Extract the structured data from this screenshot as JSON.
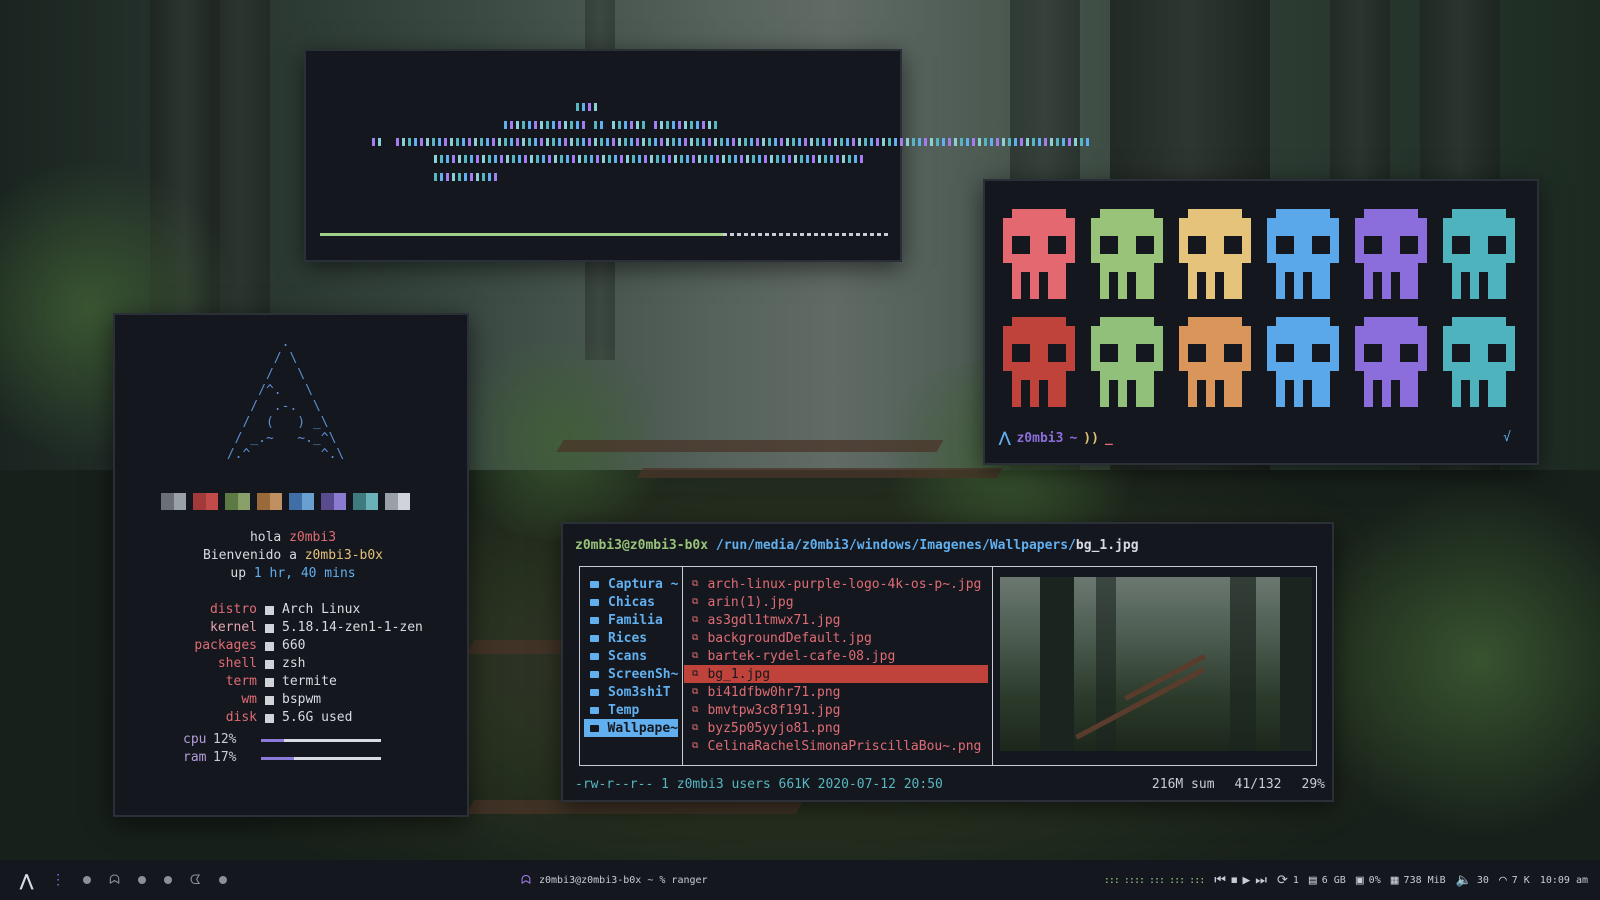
{
  "colors": {
    "bg_window": "#14171d",
    "red": "#e06c75",
    "green": "#98c379",
    "yellow": "#e5c07b",
    "blue": "#61afef",
    "purple": "#a37ef0",
    "cyan": "#56b6c2"
  },
  "visualizer": {
    "progress": 0.71
  },
  "skulls": {
    "row1": [
      "#e3686f",
      "#98c379",
      "#e6c37b",
      "#5aa8ea",
      "#8b6ddc",
      "#4eb3bd"
    ],
    "row2": [
      "#c0433b",
      "#90c079",
      "#d9955a",
      "#5aa8ea",
      "#8b6ddc",
      "#4eb3bd"
    ],
    "prompt": {
      "icon": "arch-icon",
      "user": "z0mbi3",
      "tilde": "~",
      "arrows": "))",
      "cursor": "_",
      "check": "√"
    }
  },
  "neofetch": {
    "ascii": "        .\n       / \\\n      /   \\\n     /^.   \\\n    /  .-.  \\\n   /  (   ) _\\\n  / _.~   ~._^\\\n /.^         ^.\\",
    "palette": [
      [
        "#6b6f76",
        "#9aa0a8"
      ],
      [
        "#a23a3a",
        "#c24a48"
      ],
      [
        "#5d7a44",
        "#8aa06a"
      ],
      [
        "#9a6a3a",
        "#c09060"
      ],
      [
        "#3f6fa6",
        "#6aa0d0"
      ],
      [
        "#5a4a8e",
        "#8a7ad0"
      ],
      [
        "#3e7a80",
        "#6ab2b8"
      ],
      [
        "#9aa0a8",
        "#d0d4da"
      ]
    ],
    "greeting": {
      "hola": "hola",
      "user": "z0mbi3",
      "welcome": "Bienvenido a",
      "host": "z0mbi3-b0x",
      "up_label": "up",
      "uptime": "1 hr, 40 mins"
    },
    "info": [
      {
        "key": "distro",
        "value": "Arch Linux"
      },
      {
        "key": "kernel",
        "value": "5.18.14-zen1-1-zen"
      },
      {
        "key": "packages",
        "value": "660"
      },
      {
        "key": "shell",
        "value": "zsh"
      },
      {
        "key": "term",
        "value": "termite"
      },
      {
        "key": "wm",
        "value": "bspwm"
      },
      {
        "key": "disk",
        "value": "5.6G used"
      }
    ],
    "meters": [
      {
        "key": "cpu",
        "value": "12%",
        "fraction": 0.12
      },
      {
        "key": "ram",
        "value": "17%",
        "fraction": 0.17
      }
    ]
  },
  "ranger": {
    "userhost": "z0mbi3@z0mbi3-b0x",
    "path": "/run/media/z0mbi3/windows/Imagenes/Wallpapers/",
    "file": "bg_1.jpg",
    "dirs": [
      {
        "name": "Captura ~",
        "selected": false
      },
      {
        "name": "Chicas",
        "selected": false
      },
      {
        "name": "Familia",
        "selected": false
      },
      {
        "name": "Rices",
        "selected": false
      },
      {
        "name": "Scans",
        "selected": false
      },
      {
        "name": "ScreenSh~",
        "selected": false
      },
      {
        "name": "Som3shiT",
        "selected": false
      },
      {
        "name": "Temp",
        "selected": false
      },
      {
        "name": "Wallpape~",
        "selected": true
      }
    ],
    "files": [
      {
        "name": "arch-linux-purple-logo-4k-os-p~.jpg",
        "selected": false
      },
      {
        "name": "arin(1).jpg",
        "selected": false
      },
      {
        "name": "as3gdl1tmwx71.jpg",
        "selected": false
      },
      {
        "name": "backgroundDefault.jpg",
        "selected": false
      },
      {
        "name": "bartek-rydel-cafe-08.jpg",
        "selected": false
      },
      {
        "name": "bg_1.jpg",
        "selected": true
      },
      {
        "name": "bi41dfbw0hr71.png",
        "selected": false
      },
      {
        "name": "bmvtpw3c8f191.jpg",
        "selected": false
      },
      {
        "name": "byz5p05yyjo81.png",
        "selected": false
      },
      {
        "name": "CelinaRachelSimonaPriscillaBou~.png",
        "selected": false
      }
    ],
    "status_left": "-rw-r--r-- 1 z0mbi3 users 661K 2020-07-12 20:50",
    "status_sum": "216M sum",
    "status_pos": "41/132",
    "status_pct": "29%"
  },
  "taskbar": {
    "window_title": "z0mbi3@z0mbi3-b0x ~ % ranger",
    "equalizer": "::: :::: ::: ::: :::",
    "repeat_count": "1",
    "storage": "6 GB",
    "cpu": "0%",
    "memory": "738 MiB",
    "volume": "30",
    "network": "7 K",
    "clock": "10:09 am"
  }
}
